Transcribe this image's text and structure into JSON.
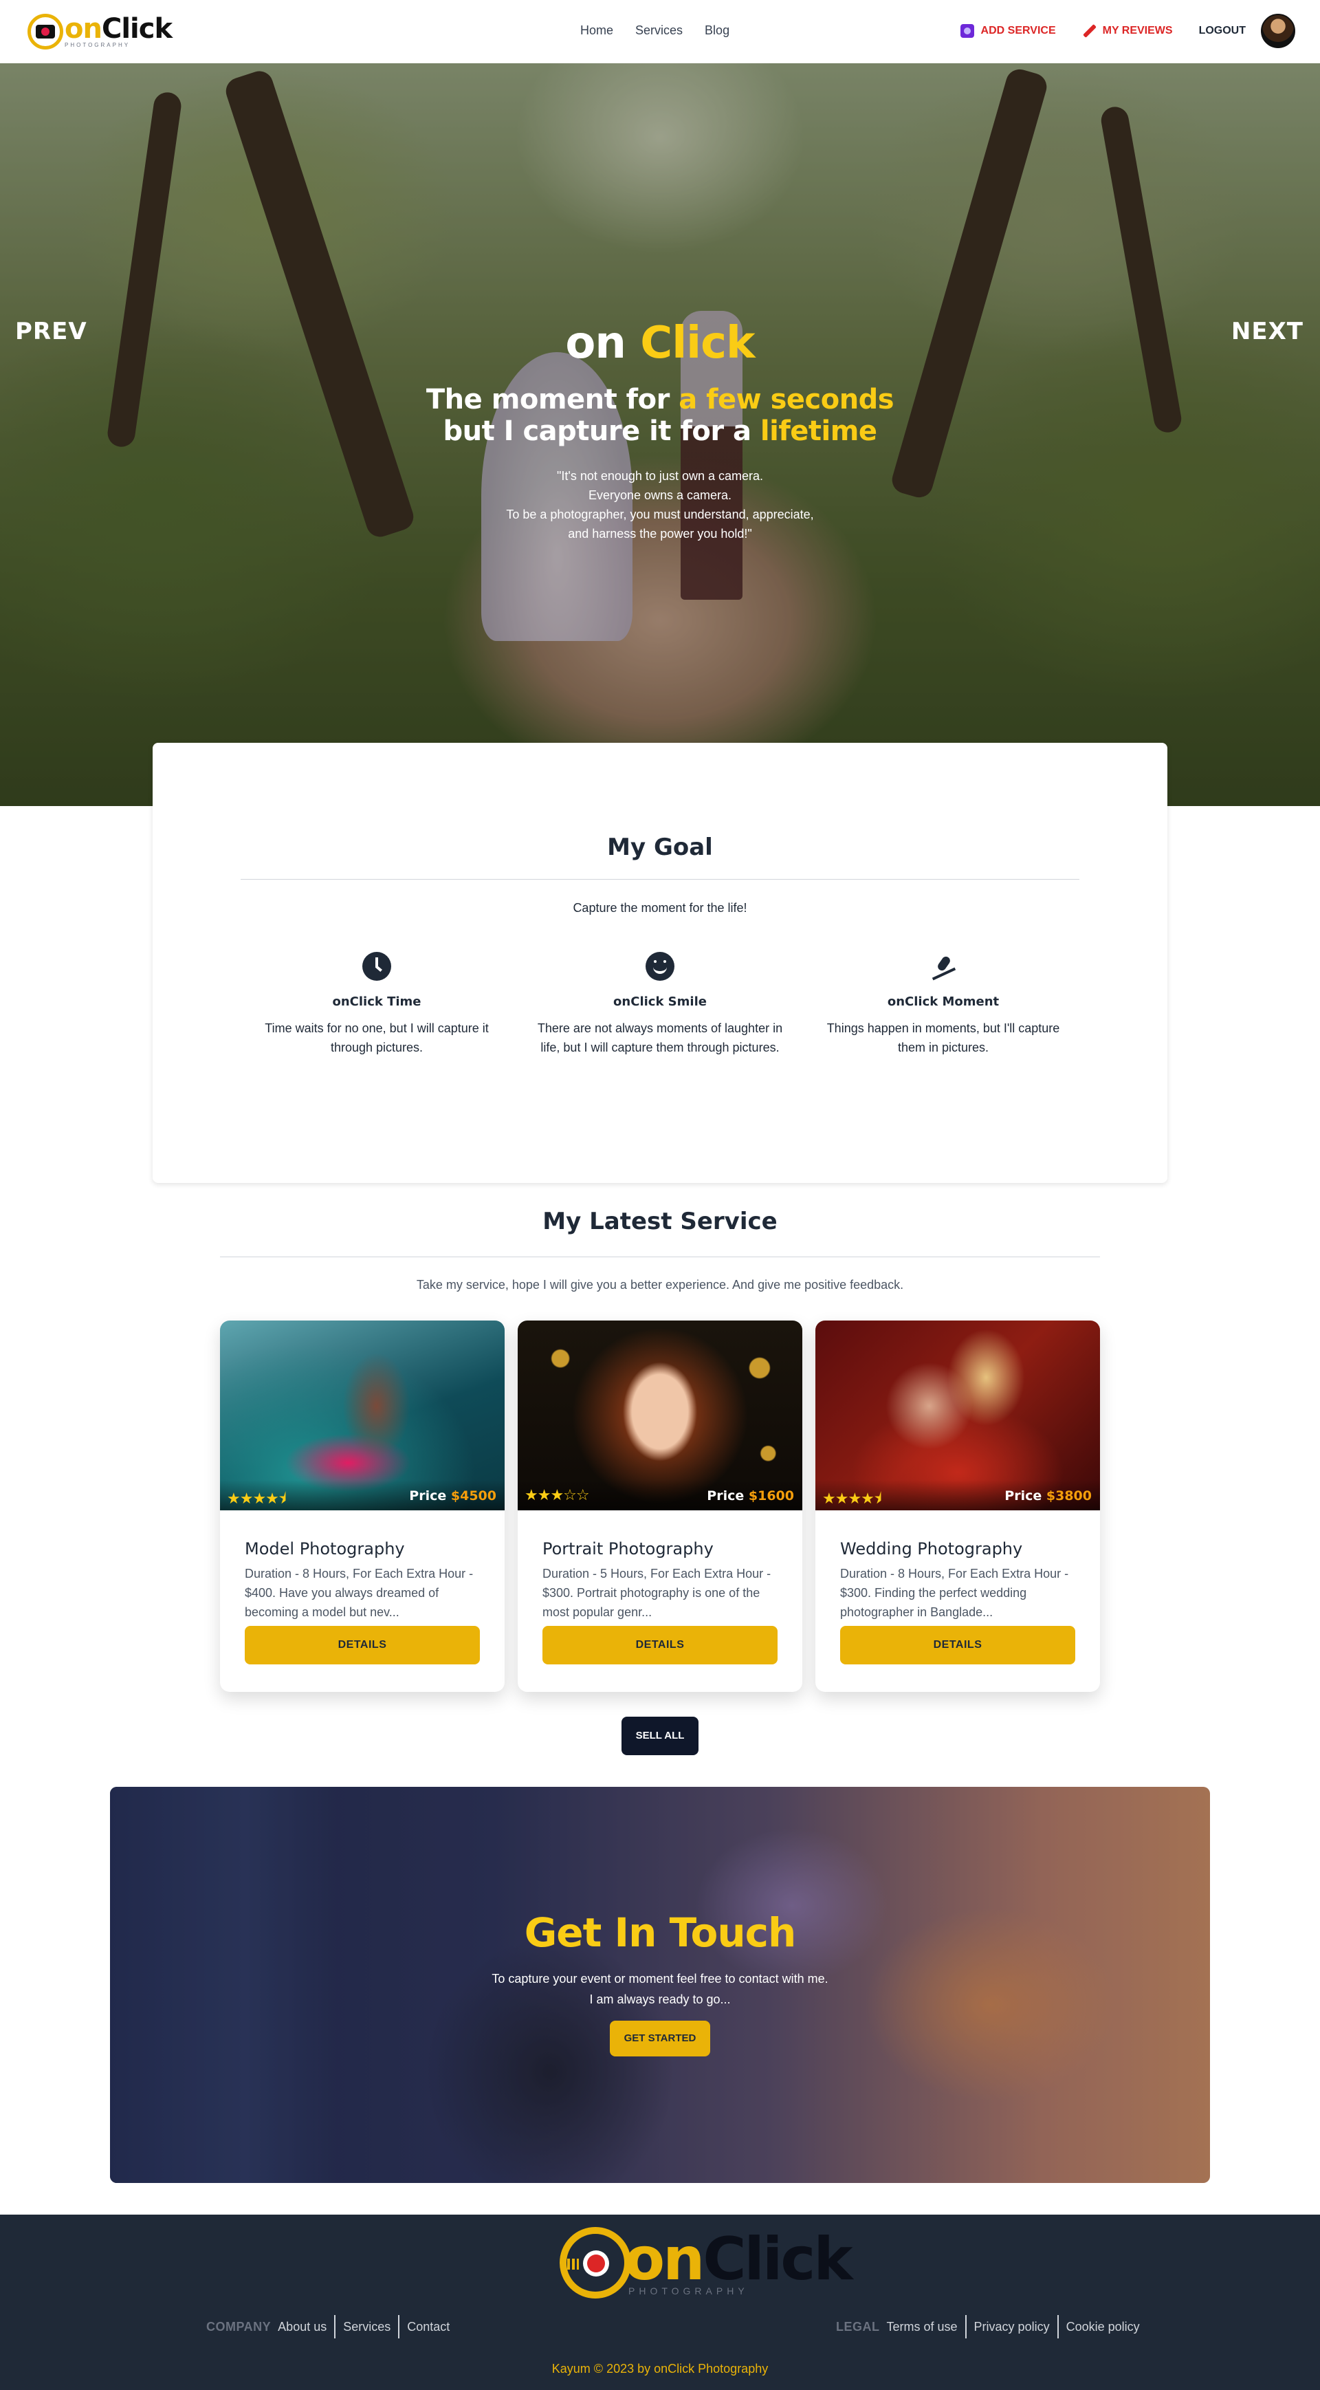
{
  "nav": {
    "logo_on": "on",
    "logo_click": "Click",
    "logo_sub": "PHOTOGRAPHY",
    "links": [
      "Home",
      "Services",
      "Blog"
    ],
    "add_service": "ADD SERVICE",
    "my_reviews": "MY REVIEWS",
    "logout": "LOGOUT"
  },
  "hero": {
    "prev": "PREV",
    "next": "NEXT",
    "title_on": "on",
    "title_click": "Click",
    "line1_a": "The moment for",
    "line1_b": "a few seconds",
    "line2_a": "but I capture it for a",
    "line2_b": "lifetime",
    "quote": [
      "\"It's not enough to just own a camera.",
      "Everyone owns a camera.",
      "To be a photographer, you must understand, appreciate,",
      "and harness the power you hold!\""
    ]
  },
  "goal": {
    "title": "My Goal",
    "tagline": "Capture the moment for the life!",
    "features": [
      {
        "title": "onClick Time",
        "icon": "clock-icon",
        "text": "Time waits for no one, but I will capture it through pictures."
      },
      {
        "title": "onClick Smile",
        "icon": "smile-icon",
        "text": "There are not always moments of laughter in life, but I will capture them through pictures."
      },
      {
        "title": "onClick Moment",
        "icon": "skiing-icon",
        "text": "Things happen in moments, but I'll capture them in pictures."
      }
    ]
  },
  "latest": {
    "title": "My Latest Service",
    "subtitle": "Take my service, hope I will give you a better experience. And give me positive feedback.",
    "cards": [
      {
        "title": "Model Photography",
        "stars": "★★★★⯨",
        "rating": 4.5,
        "price_label": "Price",
        "price": "$4500",
        "desc": "Duration - 8 Hours, For Each Extra Hour - $400. Have you always dreamed of becoming a model but nev...",
        "button": "DETAILS"
      },
      {
        "title": "Portrait Photography",
        "stars": "★★★☆☆",
        "rating": 3,
        "price_label": "Price",
        "price": "$1600",
        "desc": "Duration - 5 Hours, For Each Extra Hour - $300. Portrait photography is one of the most popular genr...",
        "button": "DETAILS"
      },
      {
        "title": "Wedding Photography",
        "stars": "★★★★⯨",
        "rating": 4.5,
        "price_label": "Price",
        "price": "$3800",
        "desc": "Duration - 8 Hours, For Each Extra Hour - $300. Finding the perfect wedding photographer in Banglade...",
        "button": "DETAILS"
      }
    ],
    "sell_all": "SELL ALL"
  },
  "touch": {
    "title": "Get In Touch",
    "line1": "To capture your event or moment feel free to contact with me.",
    "line2": "I am always ready to go...",
    "button": "GET STARTED"
  },
  "footer": {
    "logo_on": "on",
    "logo_click": "Click",
    "logo_sub": "PHOTOGRAPHY",
    "company_label": "COMPANY",
    "company_links": [
      "About us",
      "Services",
      "Contact"
    ],
    "legal_label": "LEGAL",
    "legal_links": [
      "Terms of use",
      "Privacy policy",
      "Cookie policy"
    ],
    "copyright": "Kayum © 2023 by onClick Photography"
  },
  "colors": {
    "accent": "#eab308",
    "danger": "#dc2626",
    "dark": "#1f2937"
  }
}
